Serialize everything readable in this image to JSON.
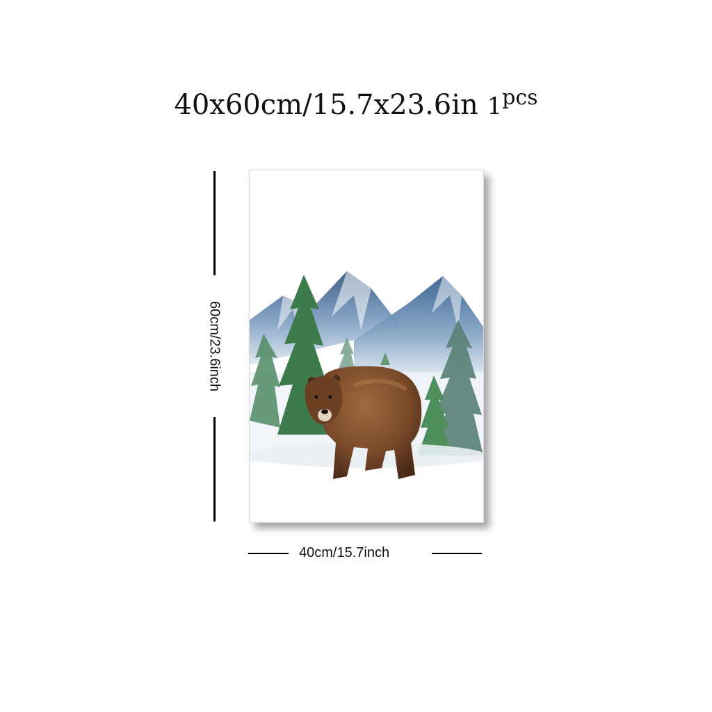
{
  "header": {
    "size_text": "40x60cm/15.7x23.6in",
    "qty_number": "1",
    "qty_unit": "pcs"
  },
  "dimensions": {
    "height_label": "60cm/23.6inch",
    "width_label": "40cm/15.7inch"
  },
  "artwork": {
    "subject": "brown bear with mountains and pine trees",
    "colors": {
      "mountain_dark": "#2f5580",
      "mountain_light": "#9fb8d2",
      "pine": "#3f7a4f",
      "bear": "#7a4a2a"
    }
  }
}
